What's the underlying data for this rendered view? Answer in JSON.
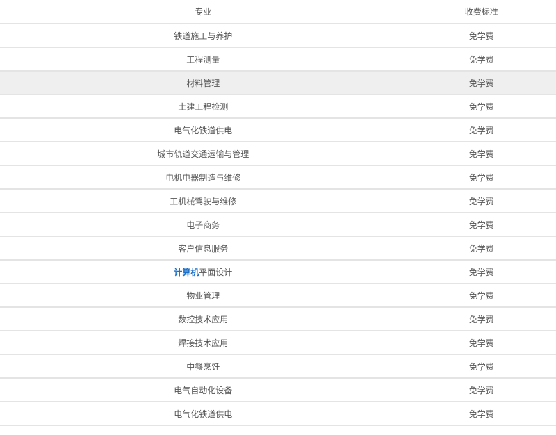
{
  "table": {
    "headers": [
      "专业",
      "收费标准"
    ],
    "rows": [
      {
        "major": "铁道施工与养护",
        "fee": "免学费"
      },
      {
        "major": "工程测量",
        "fee": "免学费"
      },
      {
        "major": "材料管理",
        "fee": "免学费",
        "highlight": true
      },
      {
        "major": "土建工程检测",
        "fee": "免学费"
      },
      {
        "major": "电气化铁道供电",
        "fee": "免学费"
      },
      {
        "major": "城市轨道交通运输与管理",
        "fee": "免学费"
      },
      {
        "major": "电机电器制造与维修",
        "fee": "免学费"
      },
      {
        "major": "工机械驾驶与维修",
        "fee": "免学费"
      },
      {
        "major": "电子商务",
        "fee": "免学费"
      },
      {
        "major": "客户信息服务",
        "fee": "免学费"
      },
      {
        "major_link": "计算机",
        "major_rest": "平面设计",
        "fee": "免学费"
      },
      {
        "major": "物业管理",
        "fee": "免学费"
      },
      {
        "major": "数控技术应用",
        "fee": "免学费"
      },
      {
        "major": "焊接技术应用",
        "fee": "免学费"
      },
      {
        "major": "中餐烹饪",
        "fee": "免学费"
      },
      {
        "major": "电气自动化设备",
        "fee": "免学费"
      },
      {
        "major": "电气化铁道供电",
        "fee": "免学费"
      }
    ]
  },
  "colors": {
    "text": "#555555",
    "border": "#e4e4e4",
    "highlight_row": "#efefef",
    "keyword_link": "#1a6fc9"
  }
}
